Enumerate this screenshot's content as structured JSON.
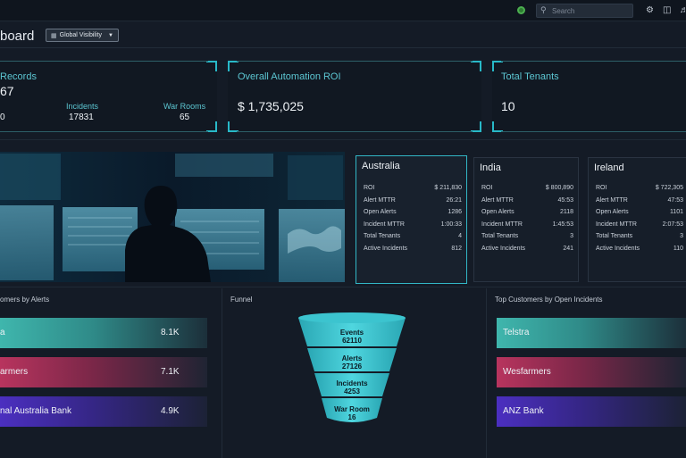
{
  "topbar": {
    "search_placeholder": "Search",
    "icons": [
      "status-dot",
      "search-icon",
      "gear-icon",
      "layout-icon",
      "bell-icon"
    ]
  },
  "header": {
    "title": "board",
    "visibility_button": "Global Visibility"
  },
  "stats": {
    "records": {
      "title": "Records",
      "value": "67",
      "incidents_label": "Incidents",
      "incidents_value": "17831",
      "warrooms_label": "War Rooms",
      "warrooms_value": "65",
      "left_value": "0"
    },
    "roi": {
      "title": "Overall Automation ROI",
      "value": "$ 1,735,025"
    },
    "tenants": {
      "title": "Total Tenants",
      "value": "10"
    }
  },
  "regions": [
    {
      "name": "Australia",
      "rows": [
        {
          "label": "ROI",
          "value": "$ 211,830"
        },
        {
          "label": "Alert MTTR",
          "value": "26:21"
        },
        {
          "label": "Open Alerts",
          "value": "1286"
        },
        {
          "label": "Incident MTTR",
          "value": "1:00:33"
        },
        {
          "label": "Total Tenants",
          "value": "4"
        },
        {
          "label": "Active Incidents",
          "value": "812"
        }
      ]
    },
    {
      "name": "India",
      "rows": [
        {
          "label": "ROI",
          "value": "$ 800,890"
        },
        {
          "label": "Alert MTTR",
          "value": "45:53"
        },
        {
          "label": "Open Alerts",
          "value": "2118"
        },
        {
          "label": "Incident MTTR",
          "value": "1:45:53"
        },
        {
          "label": "Total Tenants",
          "value": "3"
        },
        {
          "label": "Active Incidents",
          "value": "241"
        }
      ]
    },
    {
      "name": "Ireland",
      "rows": [
        {
          "label": "ROI",
          "value": "$ 722,305"
        },
        {
          "label": "Alert MTTR",
          "value": "47:53"
        },
        {
          "label": "Open Alerts",
          "value": "1101"
        },
        {
          "label": "Incident MTTR",
          "value": "2:07:53"
        },
        {
          "label": "Total Tenants",
          "value": "3"
        },
        {
          "label": "Active Incidents",
          "value": "110"
        }
      ]
    }
  ],
  "customers_by_alerts": {
    "title": "omers by Alerts",
    "items": [
      {
        "name": "a",
        "value": "8.1K",
        "color": "#3fb6ad"
      },
      {
        "name": "armers",
        "value": "7.1K",
        "color": "#b8345e"
      },
      {
        "name": "nal Australia Bank",
        "value": "4.9K",
        "color": "#4b2fc0"
      }
    ]
  },
  "funnel": {
    "title": "Funnel",
    "stages": [
      {
        "label": "Events",
        "value": "62110"
      },
      {
        "label": "Alerts",
        "value": "27126"
      },
      {
        "label": "Incidents",
        "value": "4253"
      },
      {
        "label": "War Room",
        "value": "16"
      }
    ]
  },
  "top_customers": {
    "title": "Top Customers by Open Incidents",
    "items": [
      {
        "name": "Telstra",
        "color": "#3fb6ad"
      },
      {
        "name": "Wesfarmers",
        "color": "#b8345e"
      },
      {
        "name": "ANZ Bank",
        "color": "#4b2fc0"
      }
    ]
  }
}
